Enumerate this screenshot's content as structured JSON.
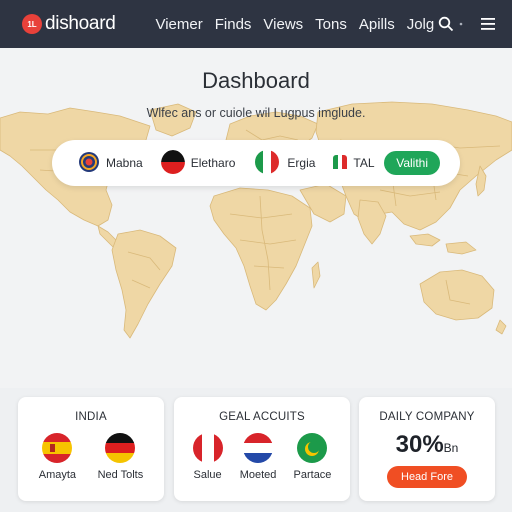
{
  "app": {
    "logo_text": "1L",
    "name": "dishoard"
  },
  "nav": {
    "items": [
      "Viemer",
      "Finds",
      "Views",
      "Tons",
      "Apills",
      "Jolg"
    ]
  },
  "tools": {
    "search_icon": "search-icon",
    "more_icon": "dot-icon",
    "menu_icon": "hamburger-menu-icon"
  },
  "hero": {
    "title": "Dashboard",
    "subtitle": "Wlfec ans or cuiole wil Lugpus imglude."
  },
  "filters": {
    "chips": [
      {
        "label": "Mabna",
        "flag": "globe-flag"
      },
      {
        "label": "Eletharo",
        "flag": "black-red-flag"
      },
      {
        "label": "Ergia",
        "flag": "italy-flag"
      },
      {
        "label": "TAL",
        "flag": "italy-flag"
      }
    ],
    "action_label": "Valithi",
    "action_color": "#1fa659"
  },
  "cards": [
    {
      "title": "INDIA",
      "flags": [
        {
          "label": "Amayta",
          "flag": "spain-flag"
        },
        {
          "label": "Ned Tolts",
          "flag": "germany-flag"
        }
      ]
    },
    {
      "title": "GEAL ACCUITS",
      "flags": [
        {
          "label": "Salue",
          "flag": "red-white-flag"
        },
        {
          "label": "Moeted",
          "flag": "netherlands-flag"
        },
        {
          "label": "Partace",
          "flag": "green-crescent-flag"
        }
      ]
    },
    {
      "title": "DAILY COMPANY",
      "value": "30%",
      "unit": "Bn",
      "button_label": "Head Fore",
      "button_color": "#f04e23"
    }
  ],
  "colors": {
    "topbar": "#2e3442",
    "map_land": "#efd7a5",
    "map_borders": "#d9b97a",
    "brand_accent": "#e8413a"
  }
}
